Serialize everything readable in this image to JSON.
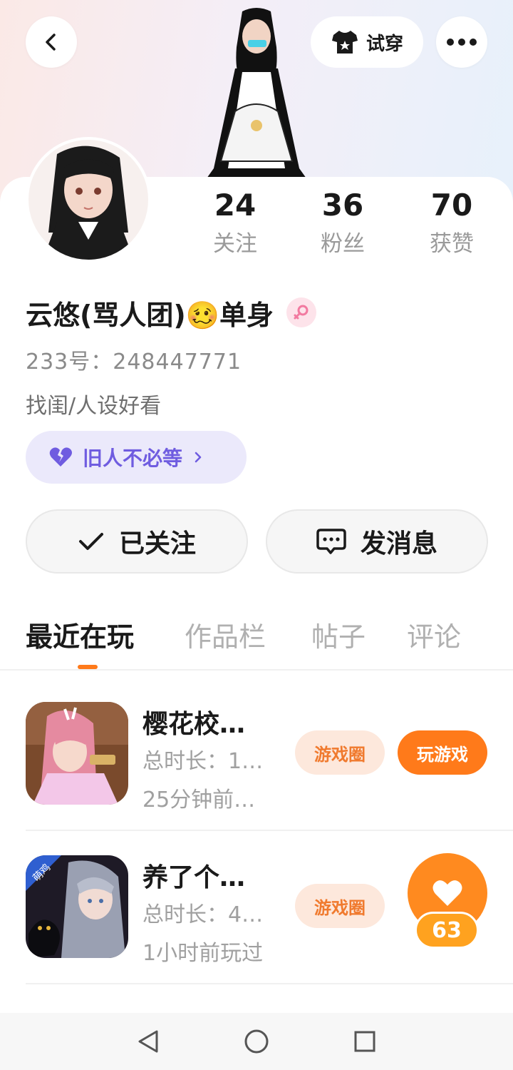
{
  "header": {
    "tryon_label": "试穿",
    "icons": {
      "back": "chevron-left-icon",
      "tryon": "tshirt-icon",
      "more": "more-dots-icon"
    }
  },
  "stats": [
    {
      "value": "24",
      "label": "关注"
    },
    {
      "value": "36",
      "label": "粉丝"
    },
    {
      "value": "70",
      "label": "获赞"
    }
  ],
  "profile": {
    "name": "云悠(骂人团)🥴单身",
    "gender": "female",
    "id_line": "233号：248447771",
    "bio": "找闺/人设好看",
    "tag": "旧人不必等"
  },
  "actions": {
    "follow_label": "已关注",
    "message_label": "发消息"
  },
  "tabs": [
    "最近在玩",
    "作品栏",
    "帖子",
    "评论"
  ],
  "games": [
    {
      "title": "樱花校…",
      "duration": "总时长：1…",
      "last_played": "25分钟前…",
      "circle_label": "游戏圈",
      "play_label": "玩游戏"
    },
    {
      "title": "养了个…",
      "duration": "总时长：4…",
      "last_played": "1小时前玩过",
      "circle_label": "游戏圈"
    }
  ],
  "floating_like": {
    "count": "63"
  },
  "colors": {
    "accent": "#ff7a1a",
    "tag_bg": "#ebe9fb",
    "tag_text": "#6f5ce0",
    "pill_bg": "#fde8dc"
  }
}
